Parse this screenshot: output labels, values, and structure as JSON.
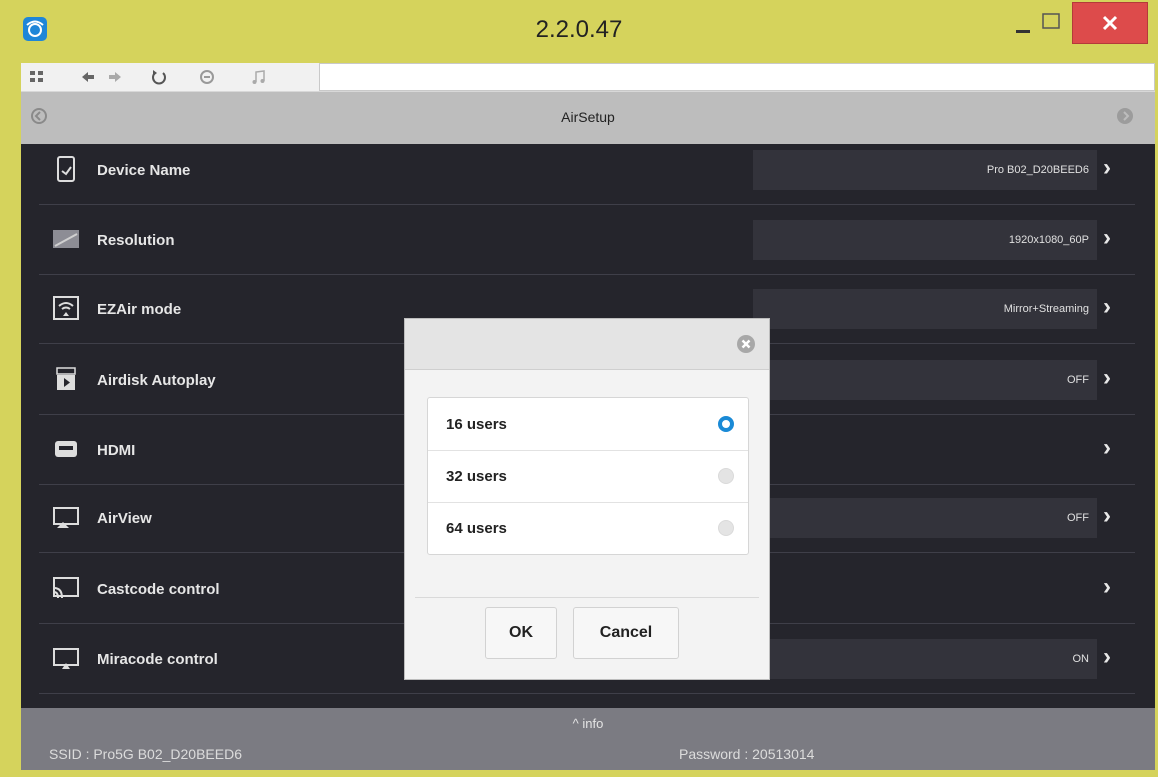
{
  "window": {
    "title": "2.2.0.47",
    "url": ""
  },
  "app": {
    "title": "AirSetup"
  },
  "settings": [
    {
      "label": "Device Name",
      "value": "Pro B02_D20BEED6",
      "icon": "device-phone-icon"
    },
    {
      "label": "Resolution",
      "value": "1920x1080_60P",
      "icon": "monitor-icon"
    },
    {
      "label": "EZAir mode",
      "value": "Mirror+Streaming",
      "icon": "wifi-screen-icon"
    },
    {
      "label": "Airdisk Autoplay",
      "value": "OFF",
      "icon": "play-disk-icon"
    },
    {
      "label": "HDMI",
      "value": "",
      "icon": "hdmi-icon"
    },
    {
      "label": "AirView",
      "value": "OFF",
      "icon": "airview-icon"
    },
    {
      "label": "Castcode control",
      "value": "",
      "icon": "cast-icon"
    },
    {
      "label": "Miracode control",
      "value": "ON",
      "icon": "screen-cast-icon"
    }
  ],
  "dialog": {
    "options": [
      {
        "label": "16 users",
        "selected": true
      },
      {
        "label": "32 users",
        "selected": false
      },
      {
        "label": "64 users",
        "selected": false
      }
    ],
    "ok_label": "OK",
    "cancel_label": "Cancel"
  },
  "footer": {
    "info_label": "^ info",
    "ssid": "SSID : Pro5G B02_D20BEED6",
    "password": "Password : 20513014"
  },
  "colors": {
    "titlebar": "#d5d35c",
    "content": "#25252c",
    "accent": "#1a8ad6",
    "close": "#dd4b4b"
  }
}
